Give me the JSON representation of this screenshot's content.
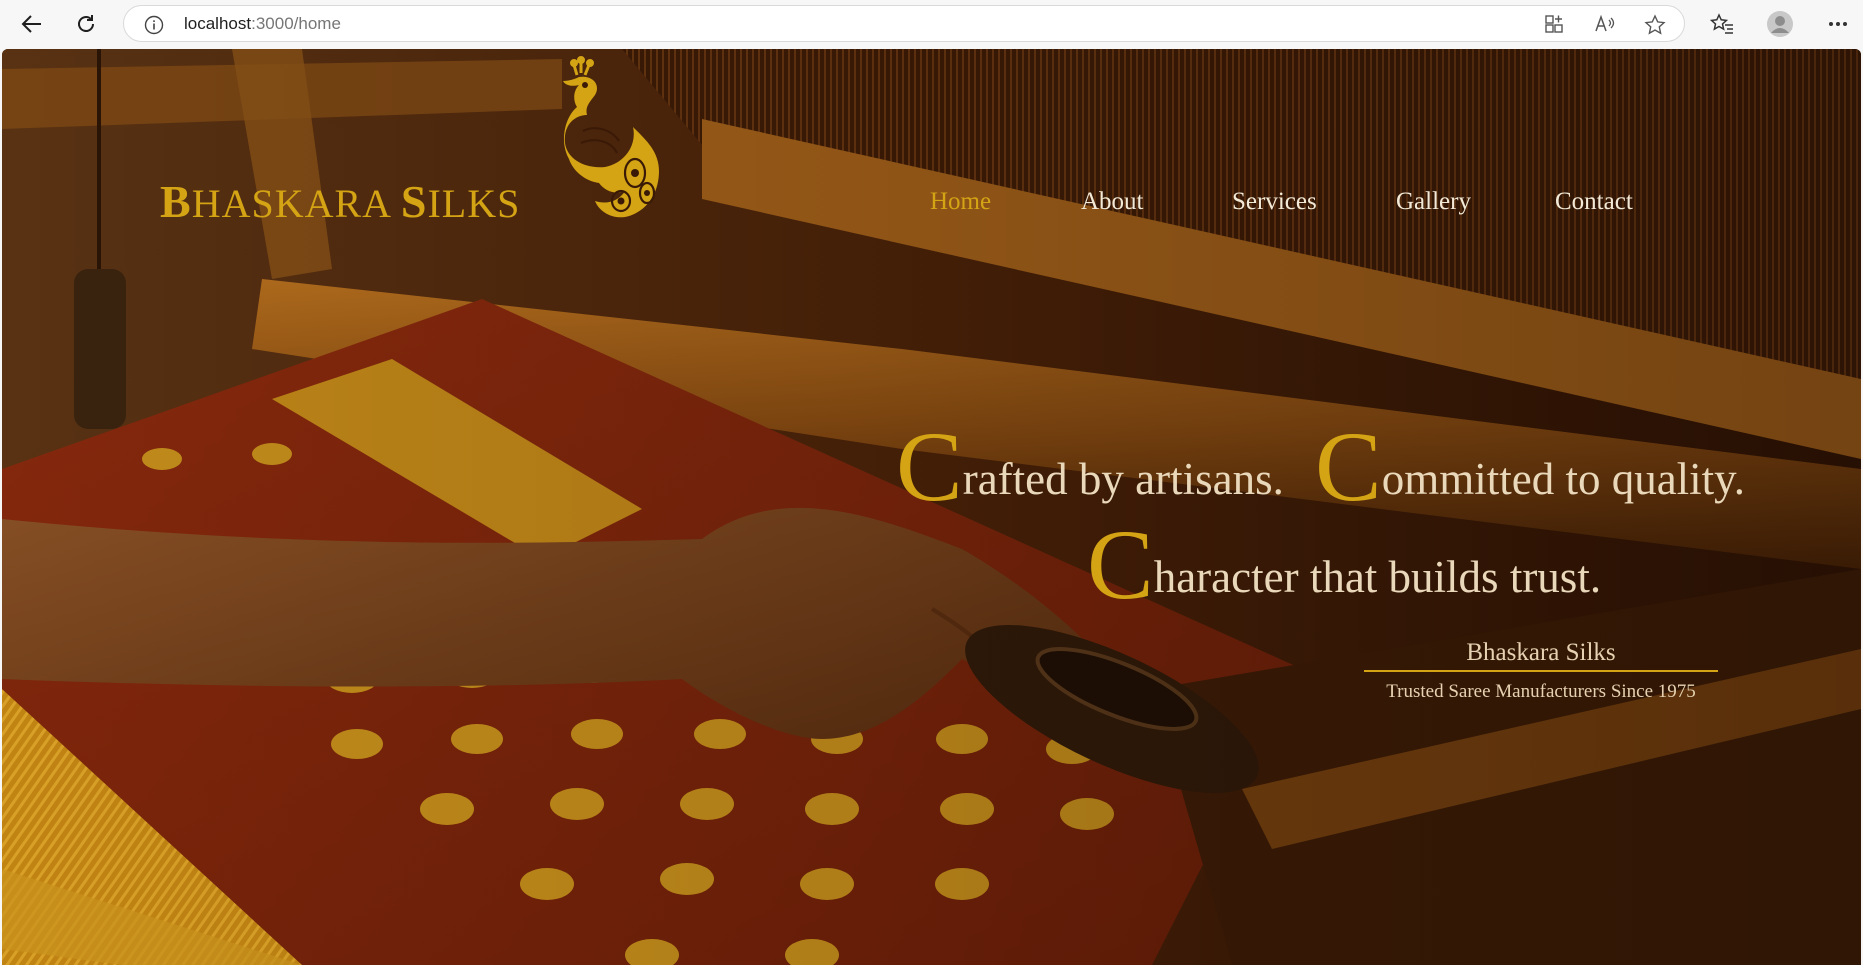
{
  "browser": {
    "url_host": "localhost",
    "url_path": ":3000/home"
  },
  "site": {
    "brand_first_initial": "B",
    "brand_first_rest": "HASKARA ",
    "brand_second_initial": "S",
    "brand_second_rest": "ILKS",
    "nav": {
      "home": "Home",
      "about": "About",
      "services": "Services",
      "gallery": "Gallery",
      "contact": "Contact"
    },
    "tagline": {
      "line1a_cap": "C",
      "line1a_rest": "rafted by artisans.",
      "line1b_cap": "C",
      "line1b_rest": "ommitted to quality.",
      "line2_cap": "C",
      "line2_rest": "haracter that builds trust."
    },
    "sub_title": "Bhaskara Silks",
    "sub_caption": "Trusted Saree Manufacturers Since 1975"
  },
  "colors": {
    "accent_gold": "#d4a415",
    "nav_text": "#f3e9d7",
    "tagline_text": "#ead8bb"
  },
  "icons": [
    "back-arrow-icon",
    "refresh-icon",
    "info-icon",
    "app-grid-icon",
    "read-aloud-icon",
    "star-icon",
    "favorites-icon",
    "profile-icon",
    "more-icon",
    "peacock-logo"
  ]
}
